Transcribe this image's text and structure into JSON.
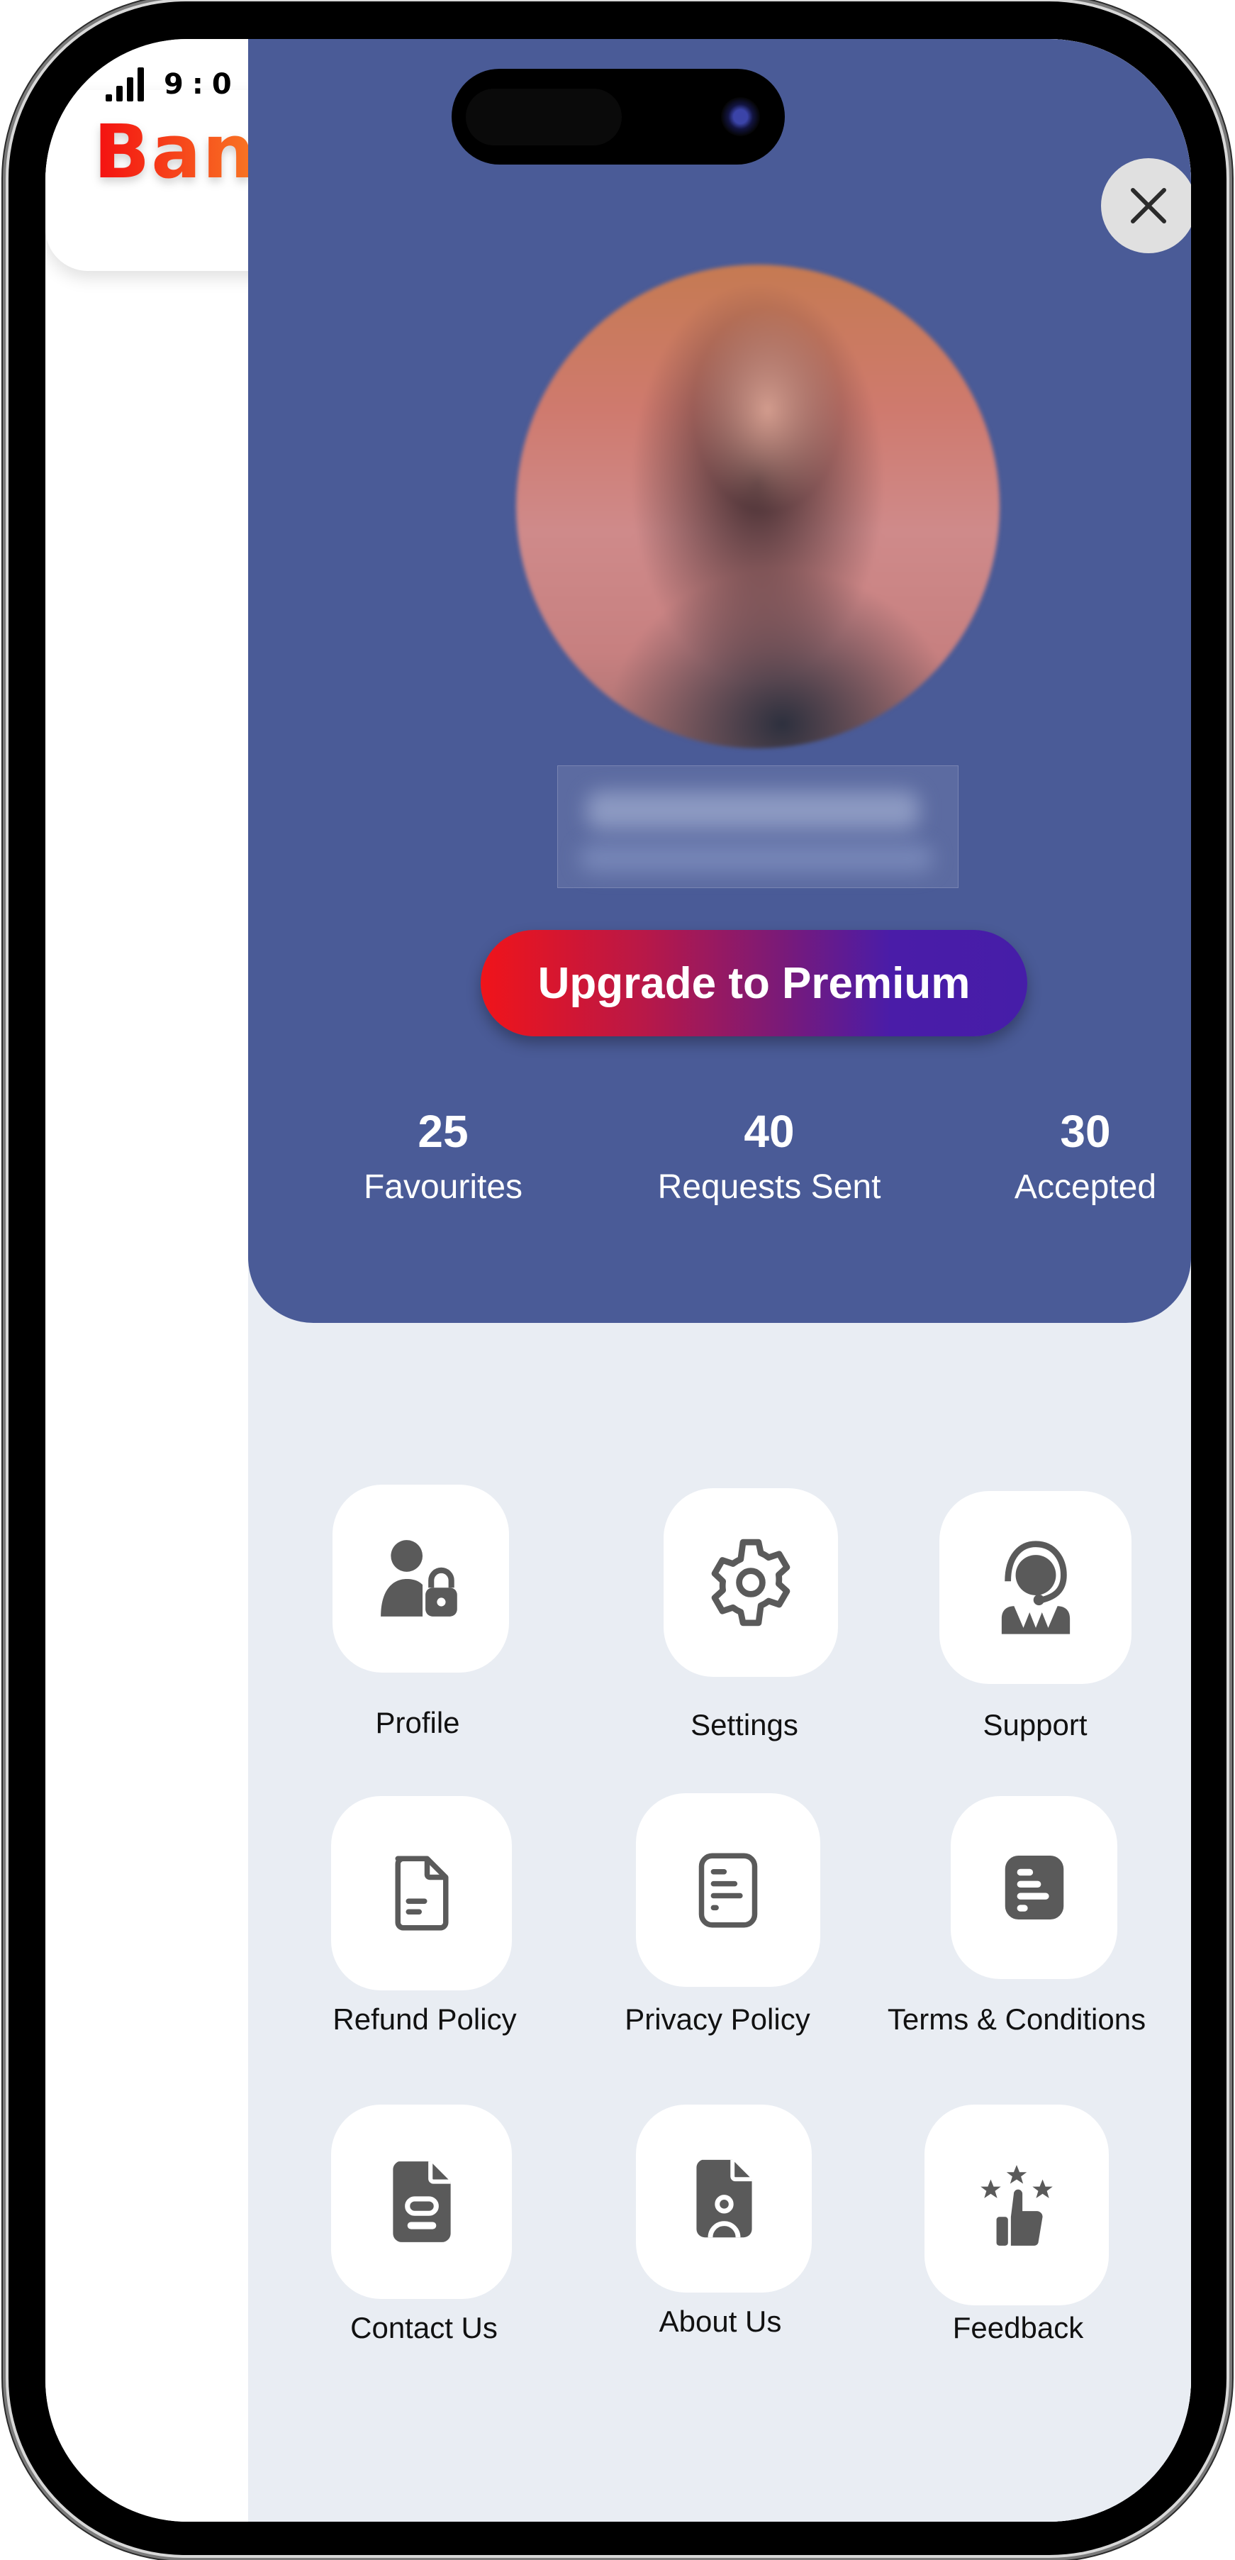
{
  "status_bar": {
    "time": "9:0",
    "signal_icon": "cellular-signal-icon"
  },
  "background_app": {
    "logo_text": "Banc"
  },
  "drawer": {
    "close_icon": "close-icon",
    "avatar_alt": "profile-photo (blurred)",
    "name_redacted": true,
    "upgrade_button": "Upgrade to Premium",
    "stats": [
      {
        "value": "25",
        "label": "Favourites"
      },
      {
        "value": "40",
        "label": "Requests Sent"
      },
      {
        "value": "30",
        "label": "Accepted"
      }
    ],
    "menu": [
      {
        "label": "Profile",
        "icon": "user-lock-icon"
      },
      {
        "label": "Settings",
        "icon": "gear-icon"
      },
      {
        "label": "Support",
        "icon": "headset-agent-icon"
      },
      {
        "label": "Refund Policy",
        "icon": "document-outline-icon"
      },
      {
        "label": "Privacy Policy",
        "icon": "document-lines-outline-icon"
      },
      {
        "label": "Terms  & Conditions",
        "icon": "document-lines-filled-icon"
      },
      {
        "label": "Contact Us",
        "icon": "document-contact-icon"
      },
      {
        "label": "About Us",
        "icon": "document-person-icon"
      },
      {
        "label": "Feedback",
        "icon": "thumbs-up-stars-icon"
      }
    ]
  },
  "colors": {
    "drawer_header": "#4a5b97",
    "drawer_body": "#e9edf3",
    "icon_gray": "#5a5a5a",
    "upgrade_gradient_start": "#f0141a",
    "upgrade_gradient_end": "#461da8",
    "logo_red": "#f40f10",
    "logo_orange": "#f86c22"
  }
}
